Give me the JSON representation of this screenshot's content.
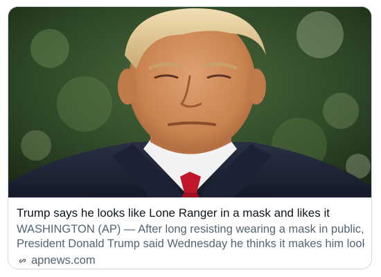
{
  "card": {
    "headline": "Trump says he looks like Lone Ranger in a mask and likes it",
    "description_line1": "WASHINGTON (AP) — After long resisting wearing a mask in public,",
    "description_line2": "President Donald Trump said Wednesday he thinks it makes him look ...",
    "domain": "apnews.com",
    "link_icon": "link-icon"
  }
}
